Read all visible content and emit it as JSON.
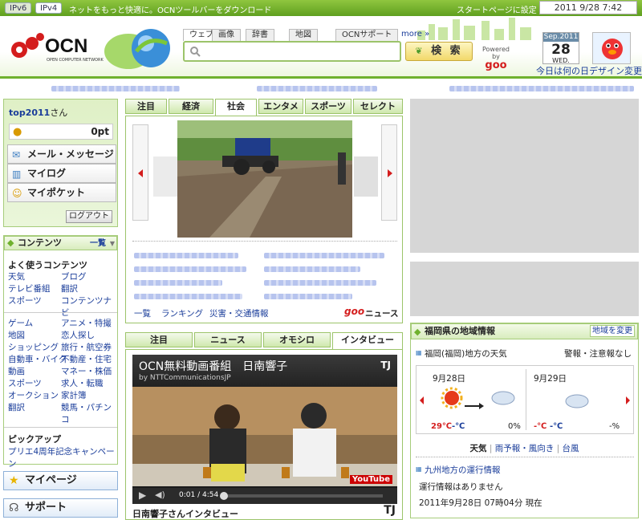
{
  "topbar": {
    "ipv6": "IPv6",
    "ipv4": "IPv4",
    "promo": "ネットをもっと快適に。OCNツールバーをダウンロード",
    "startpage": "スタートページに設定",
    "clock": "2011 9/28 7:42"
  },
  "header": {
    "logo": "OCN",
    "logo_sub": "OPEN COMPUTER NETWORK",
    "search_tabs": [
      "ウェブ",
      "画像",
      "辞書",
      "地図"
    ],
    "support_tab": "OCNサポート",
    "more": "more »",
    "search_button": "検 索",
    "powered_by": "Powered by",
    "goo": "goo",
    "cal_month": "Sep.2011",
    "cal_day": "28",
    "cal_weekday": "WED.",
    "today_link": "今日は何の日",
    "design_link": "デザイン変更"
  },
  "user": {
    "name": "top2011",
    "san": "さん",
    "points": "0pt",
    "menu": [
      "メール・メッセージ",
      "マイログ",
      "マイポケット"
    ],
    "logout": "ログアウト"
  },
  "contents": {
    "title": "コンテンツ",
    "list_link": "一覧",
    "frequent_title": "よく使うコンテンツ",
    "frequent": [
      [
        "天気",
        "ブログ"
      ],
      [
        "テレビ番組",
        "翻訳"
      ],
      [
        "スポーツ",
        "コンテンツナビ"
      ]
    ],
    "all": [
      [
        "ゲーム",
        "アニメ・特撮"
      ],
      [
        "地図",
        "恋人探し"
      ],
      [
        "ショッピング",
        "旅行・航空券"
      ],
      [
        "自動車・バイク",
        "不動産・住宅"
      ],
      [
        "動画",
        "マネー・株価"
      ],
      [
        "スポーツ",
        "求人・転職"
      ],
      [
        "オークション",
        "家計簿"
      ],
      [
        "翻訳",
        "競馬・パチンコ"
      ]
    ],
    "pickup_title": "ピックアップ",
    "pickup": "プリエ4周年記念キャンペーン"
  },
  "left_buttons": {
    "mypage": "マイページ",
    "support": "サポート"
  },
  "news": {
    "tabs": [
      "注目",
      "経済",
      "社会",
      "エンタメ",
      "スポーツ",
      "セレクト"
    ],
    "active_tab": "社会",
    "links": [
      "一覧",
      "ランキング",
      "災害・交通情報"
    ],
    "brand": "ニュース",
    "brand_goo": "goo"
  },
  "video": {
    "tabs": [
      "注目",
      "ニュース",
      "オモシロ",
      "インタビュー"
    ],
    "active_tab": "インタビュー",
    "title": "OCN無料動画番組　日南響子",
    "byline": "by NTTCommunicationsJP",
    "time": "0:01 / 4:54",
    "youtube": "YouTube",
    "caption": "日南響子さんインタビュー"
  },
  "weather": {
    "title": "福岡県の地域情報",
    "change": "地域を変更",
    "area": "福岡(福岡)地方の天気",
    "alert": "警報・注意報なし",
    "day1": {
      "date": "9月28日",
      "hi": "29℃",
      "lo": "-℃",
      "rain": "0%"
    },
    "day2": {
      "date": "9月29日",
      "hi": "-℃",
      "lo": "-℃",
      "rain": "-%"
    },
    "links": [
      "天気",
      "雨予報・風向き",
      "台風"
    ],
    "train_title": "九州地方の運行情報",
    "train_status": "運行情報はありません",
    "train_time": "2011年9月28日 07時04分 現在"
  }
}
